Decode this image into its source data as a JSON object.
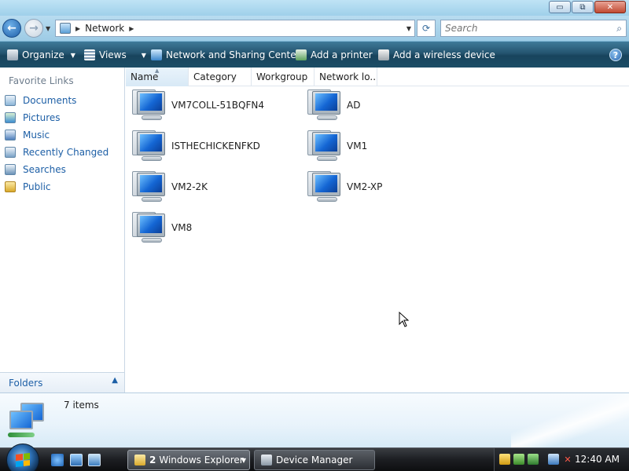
{
  "window": {
    "controls": {
      "minimize": "▭",
      "maximize": "⧉",
      "close": "✕"
    }
  },
  "address_bar": {
    "breadcrumb": [
      "Network"
    ],
    "search_placeholder": "Search"
  },
  "command_bar": {
    "items": [
      {
        "label": "Organize",
        "icon": "organize-icon",
        "has_dropdown": true
      },
      {
        "label": "Views",
        "icon": "views-icon",
        "has_dropdown": true
      },
      {
        "label": "Network and Sharing Center",
        "icon": "network-sharing-icon"
      },
      {
        "label": "Add a printer",
        "icon": "printer-icon"
      },
      {
        "label": "Add a wireless device",
        "icon": "wireless-device-icon"
      }
    ],
    "help_icon": "?"
  },
  "nav_pane": {
    "header": "Favorite Links",
    "links": [
      {
        "label": "Documents",
        "icon": "documents-icon"
      },
      {
        "label": "Pictures",
        "icon": "pictures-icon"
      },
      {
        "label": "Music",
        "icon": "music-icon"
      },
      {
        "label": "Recently Changed",
        "icon": "recently-changed-icon"
      },
      {
        "label": "Searches",
        "icon": "searches-icon"
      },
      {
        "label": "Public",
        "icon": "public-folder-icon"
      }
    ],
    "folders_label": "Folders"
  },
  "content": {
    "columns": [
      "Name",
      "Category",
      "Workgroup",
      "Network lo..."
    ],
    "sorted_column": "Name",
    "items": [
      {
        "name": "VM7COLL-51BQFN4"
      },
      {
        "name": "AD"
      },
      {
        "name": "ISTHECHICKENFKD"
      },
      {
        "name": "VM1"
      },
      {
        "name": "VM2-2K"
      },
      {
        "name": "VM2-XP"
      },
      {
        "name": "VM8"
      }
    ]
  },
  "details_pane": {
    "count": "7 items"
  },
  "taskbar": {
    "buttons": [
      {
        "label": "2 Windows Explorer",
        "count_bold": "2",
        "text": "Windows Explorer",
        "active": true
      },
      {
        "label": "Device Manager",
        "active": false
      }
    ],
    "clock": "12:40 AM"
  },
  "colors": {
    "command_bar": "#24546f",
    "link": "#1d5fa6",
    "taskbar": "#1c1e22"
  }
}
